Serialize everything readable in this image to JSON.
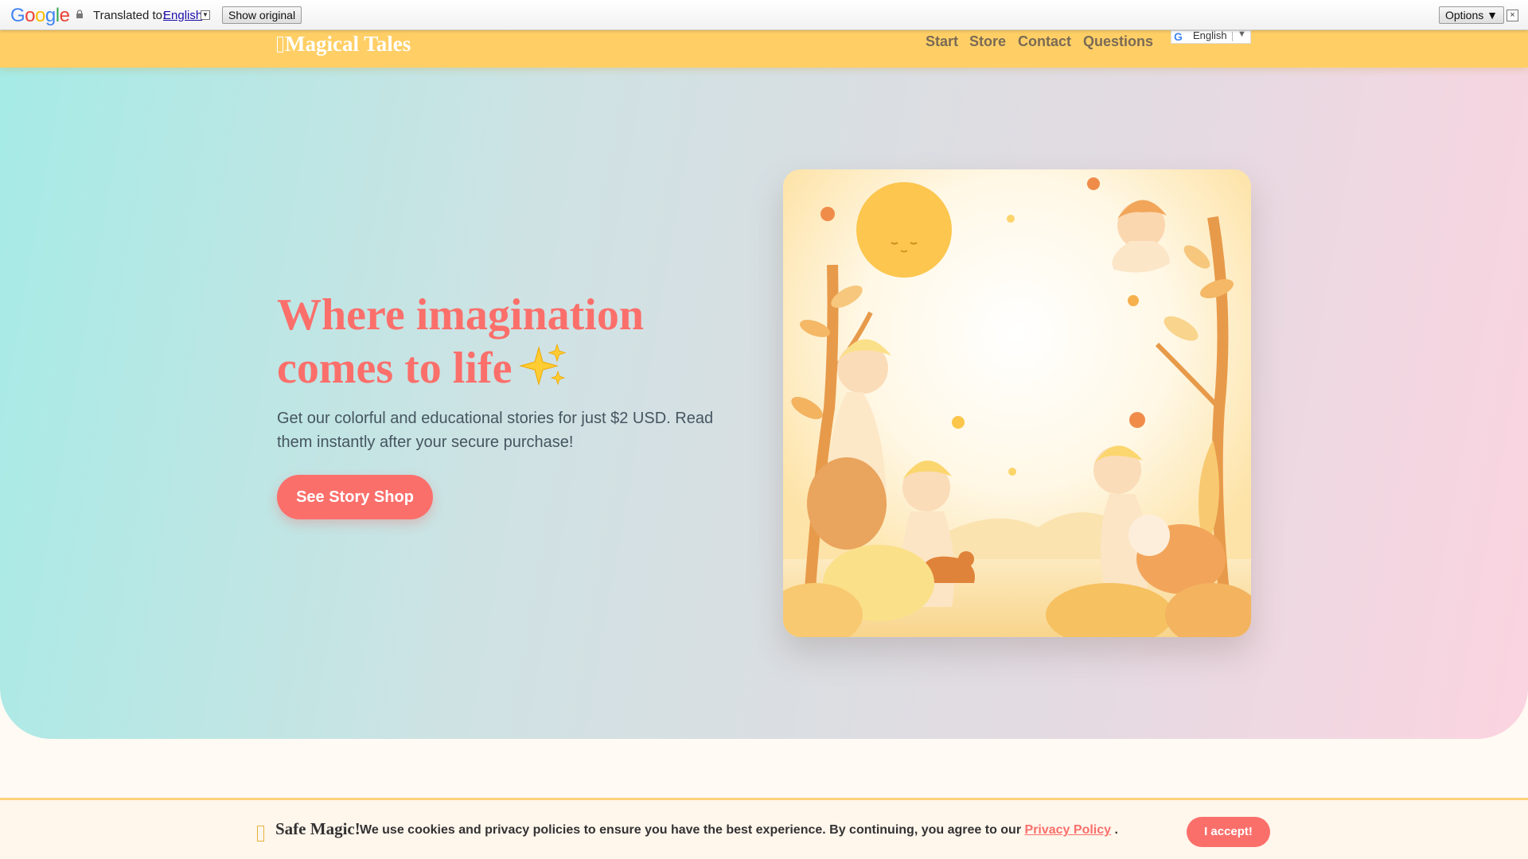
{
  "translate_bar": {
    "logo": "Google",
    "translated_to": "Translated to:",
    "language": "English",
    "show_original": "Show original",
    "options": "Options ▼",
    "close": "×"
  },
  "header": {
    "brand": "Magical Tales",
    "nav": [
      "Start",
      "Store",
      "Contact",
      "Questions"
    ],
    "language_widget": {
      "label": "English",
      "arrow": "▼"
    }
  },
  "hero": {
    "headline": "Where imagination comes to life",
    "subtext": "Get our colorful and educational stories for just $2 USD. Read them instantly after your secure purchase!",
    "cta": "See Story Shop"
  },
  "cookie": {
    "title": "Safe Magic!",
    "text": "We use cookies and privacy policies to ensure you have the best experience. By continuing, you agree to our",
    "link": "Privacy Policy",
    "period": ".",
    "accept": "I accept!"
  },
  "colors": {
    "accent": "#fb6f6b",
    "header": "#ffcf66",
    "hero_left": "#a6ebe6",
    "hero_right": "#fbd4e0"
  },
  "icons": {
    "sparkle": "sparkles-icon",
    "lock": "lock-icon",
    "cookie": "cookie-icon"
  }
}
